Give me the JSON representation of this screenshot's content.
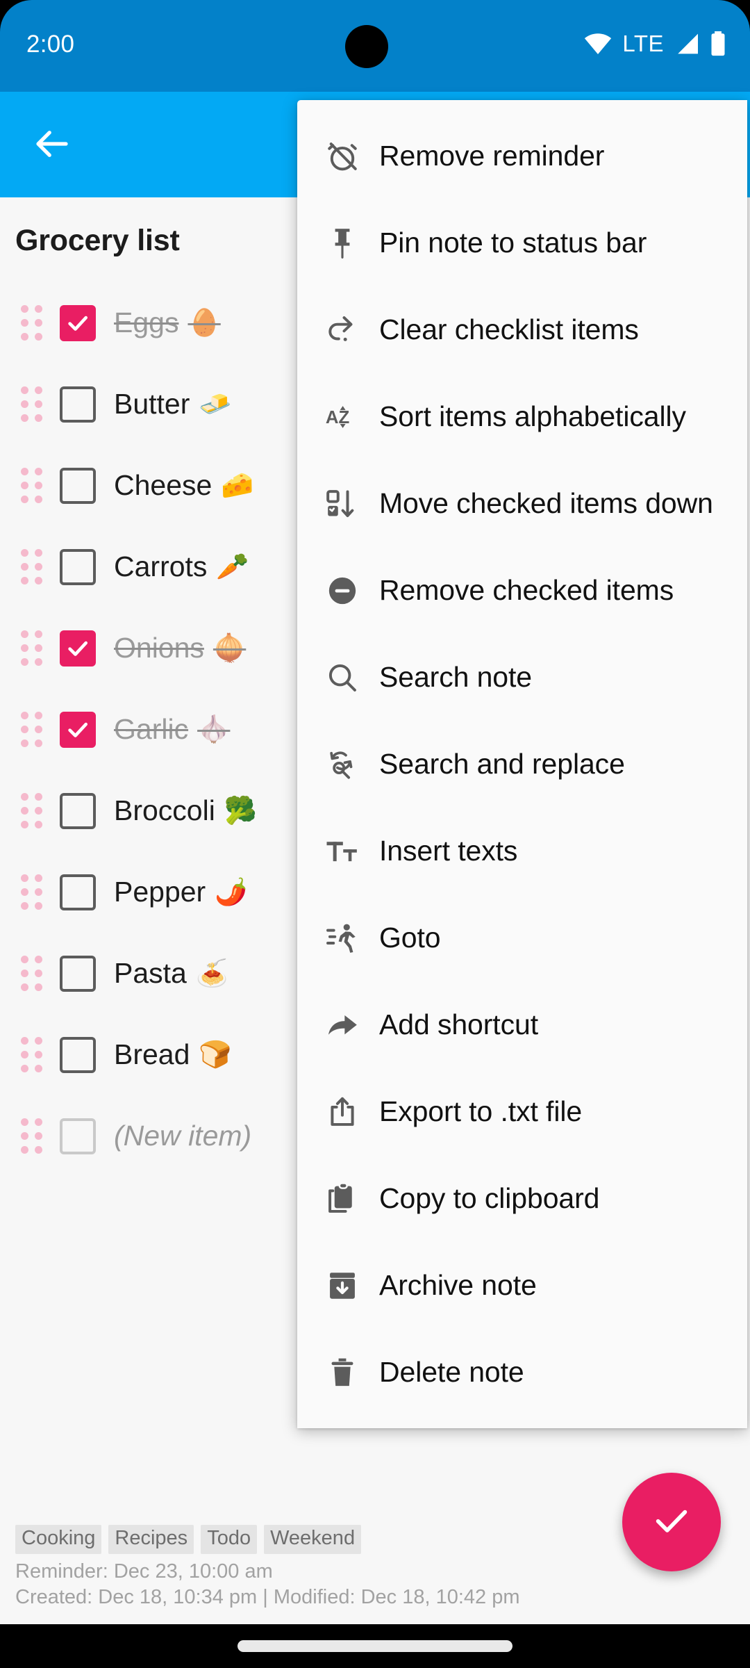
{
  "status_bar": {
    "time": "2:00",
    "network_label": "LTE",
    "icons": [
      "wifi-icon",
      "signal-icon",
      "battery-icon"
    ]
  },
  "app_bar": {
    "back_label": "Back",
    "background_color": "#03A9F4"
  },
  "note": {
    "title": "Grocery list",
    "new_item_placeholder": "(New item)",
    "items": [
      {
        "text": "Eggs",
        "emoji": "🥚",
        "checked": true
      },
      {
        "text": "Butter",
        "emoji": "🧈",
        "checked": false
      },
      {
        "text": "Cheese",
        "emoji": "🧀",
        "checked": false
      },
      {
        "text": "Carrots",
        "emoji": "🥕",
        "checked": false
      },
      {
        "text": "Onions",
        "emoji": "🧅",
        "checked": true
      },
      {
        "text": "Garlic",
        "emoji": "🧄",
        "checked": true
      },
      {
        "text": "Broccoli",
        "emoji": "🥦",
        "checked": false
      },
      {
        "text": "Pepper",
        "emoji": "🌶️",
        "checked": false
      },
      {
        "text": "Pasta",
        "emoji": "🍝",
        "checked": false
      },
      {
        "text": "Bread",
        "emoji": "🍞",
        "checked": false
      }
    ]
  },
  "footer": {
    "tags": [
      "Cooking",
      "Recipes",
      "Todo",
      "Weekend"
    ],
    "reminder": "Reminder: Dec 23, 10:00 am",
    "timestamps": "Created: Dec 18, 10:34 pm | Modified: Dec 18, 10:42 pm"
  },
  "fab": {
    "label": "Save",
    "icon": "check-icon",
    "color": "#E91E63"
  },
  "menu": {
    "items": [
      {
        "label": "Remove reminder",
        "icon": "alarm-off-icon"
      },
      {
        "label": "Pin note to status bar",
        "icon": "pin-icon"
      },
      {
        "label": "Clear checklist items",
        "icon": "redo-arrow-icon"
      },
      {
        "label": "Sort items alphabetically",
        "icon": "sort-az-icon"
      },
      {
        "label": "Move checked items down",
        "icon": "move-down-icon"
      },
      {
        "label": "Remove checked items",
        "icon": "minus-circle-icon"
      },
      {
        "label": "Search note",
        "icon": "search-icon"
      },
      {
        "label": "Search and replace",
        "icon": "search-replace-icon"
      },
      {
        "label": "Insert texts",
        "icon": "text-format-icon"
      },
      {
        "label": "Goto",
        "icon": "running-person-icon"
      },
      {
        "label": "Add shortcut",
        "icon": "share-arrow-icon"
      },
      {
        "label": "Export to .txt file",
        "icon": "export-icon"
      },
      {
        "label": "Copy to clipboard",
        "icon": "clipboard-icon"
      },
      {
        "label": "Archive note",
        "icon": "archive-icon"
      },
      {
        "label": "Delete note",
        "icon": "trash-icon"
      }
    ]
  },
  "colors": {
    "status_bar": "#0381C9",
    "app_bar": "#03A9F4",
    "accent": "#E91E63",
    "surface": "#F7F7F7"
  }
}
